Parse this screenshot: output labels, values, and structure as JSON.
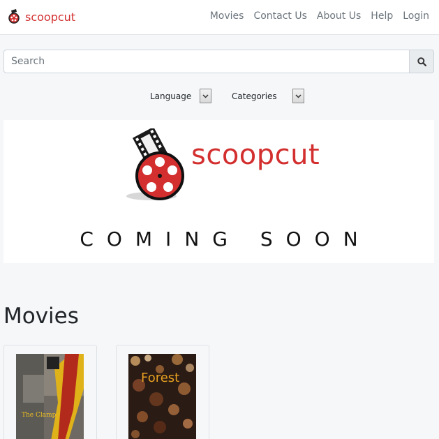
{
  "brand": {
    "name": "scoopcut"
  },
  "nav": {
    "items": [
      {
        "label": "Movies"
      },
      {
        "label": "Contact Us"
      },
      {
        "label": "About Us"
      },
      {
        "label": "Help"
      },
      {
        "label": "Login"
      }
    ]
  },
  "search": {
    "placeholder": "Search",
    "value": "",
    "icon": "search-icon"
  },
  "filters": {
    "language": {
      "label": "Language",
      "icon": "chevron-down-icon"
    },
    "categories": {
      "label": "Categories",
      "icon": "chevron-down-icon"
    }
  },
  "banner": {
    "brand": "scoopcut",
    "coming_soon": "COMING SOON"
  },
  "movies": {
    "title": "Movies",
    "items": [
      {
        "poster_title": "The Clamp"
      },
      {
        "poster_title": "Forest"
      }
    ]
  },
  "colors": {
    "brand_red": "#d32f2f",
    "page_bg": "#f6f7f9",
    "nav_text": "#6c757d"
  }
}
